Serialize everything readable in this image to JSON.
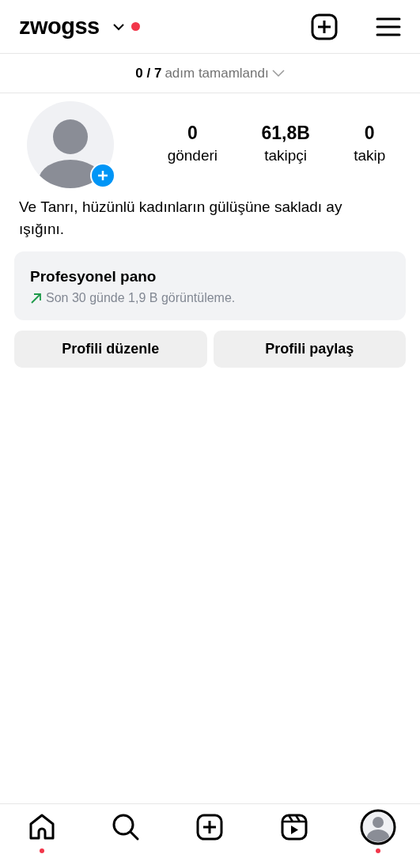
{
  "header": {
    "username": "zwogss",
    "notification": true
  },
  "progress": {
    "count": "0 / 7",
    "label": "adım tamamlandı"
  },
  "stats": [
    {
      "value": "0",
      "label": "gönderi"
    },
    {
      "value": "61,8B",
      "label": "takipçi"
    },
    {
      "value": "0",
      "label": "takip"
    }
  ],
  "bio": "Ve Tanrı, hüzünlü kadınların gülüşüne sakladı ay ışığını.",
  "dashboard": {
    "title": "Profesyonel pano",
    "subtitle": "Son 30 günde 1,9 B görüntüleme."
  },
  "buttons": [
    "Profili düzenle",
    "Profili paylaş"
  ],
  "bottom_nav": [
    {
      "kind": "home",
      "selected": false,
      "notification": true
    },
    {
      "kind": "search",
      "selected": false,
      "notification": false
    },
    {
      "kind": "create",
      "selected": false,
      "notification": false
    },
    {
      "kind": "reels",
      "selected": false,
      "notification": false
    },
    {
      "kind": "profile",
      "selected": true,
      "notification": true
    }
  ]
}
